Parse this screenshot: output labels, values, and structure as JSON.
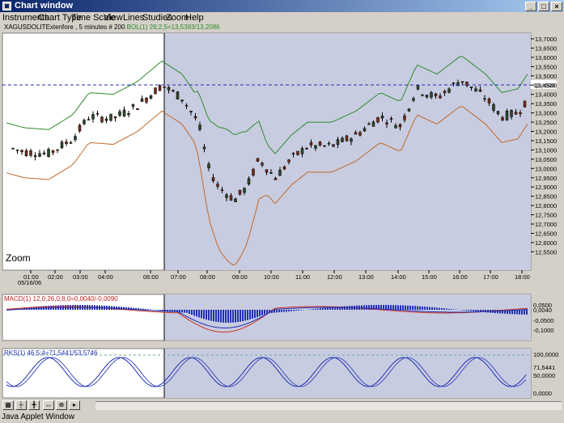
{
  "window": {
    "title": "Chart window",
    "status": "Java Applet Window"
  },
  "menu": [
    "Instruments",
    "Chart Type",
    "Time Scale",
    "View",
    "Lines",
    "Studies",
    "Zoom",
    "Help"
  ],
  "header": {
    "symbol": "XAGUSDOLITExtenfore , 5 minutes # 200",
    "bol_label": "BOL(1) 26;2,5=13,5383/13,2086"
  },
  "zoom_label": "Zoom",
  "price_axis": [
    "13,7000",
    "13,6500",
    "13,6000",
    "13,5500",
    "13,5000",
    "13,4500",
    "13,4000",
    "13,3500",
    "13,3000",
    "13,2500",
    "13,2000",
    "13,1500",
    "13,1000",
    "13,0500",
    "13,0000",
    "12,9500",
    "12,9000",
    "12,8500",
    "12,8000",
    "12,7500",
    "12,7000",
    "12,6500",
    "12,6000",
    "12,5500"
  ],
  "price_marker": "13,4600",
  "time_axis": [
    "01:00",
    "02:00",
    "03:00",
    "04:00",
    "06:00",
    "07:00",
    "08:00",
    "09:00",
    "10:00",
    "11:00",
    "12:00",
    "13:00",
    "14:00",
    "15:00",
    "16:00",
    "17:00",
    "18:00"
  ],
  "date_label": "05/16/06",
  "macd": {
    "label": "MACD(1) 12,0;26,0;8,0=0,0040/-0,0090",
    "axis": [
      "0,0500",
      "0,0040",
      "-0,0500",
      "-0,1000"
    ]
  },
  "rks": {
    "label": "RKS(1) 46,5;4=71,5441/53,5746",
    "axis": [
      "100,0000",
      "71,5441",
      "50,0000",
      "0,0000"
    ]
  },
  "colors": {
    "zoom_bg": "#c8cce0",
    "upper_band": "#2e8b2e",
    "lower_band": "#c0682a",
    "macd_line": "#d03020",
    "signal_line": "#2030b0"
  },
  "toolbar": {
    "icons": [
      "grid-icon",
      "cursor-icon",
      "crosshair-icon",
      "pan-icon",
      "zoom-icon",
      "arrow-icon"
    ]
  }
}
